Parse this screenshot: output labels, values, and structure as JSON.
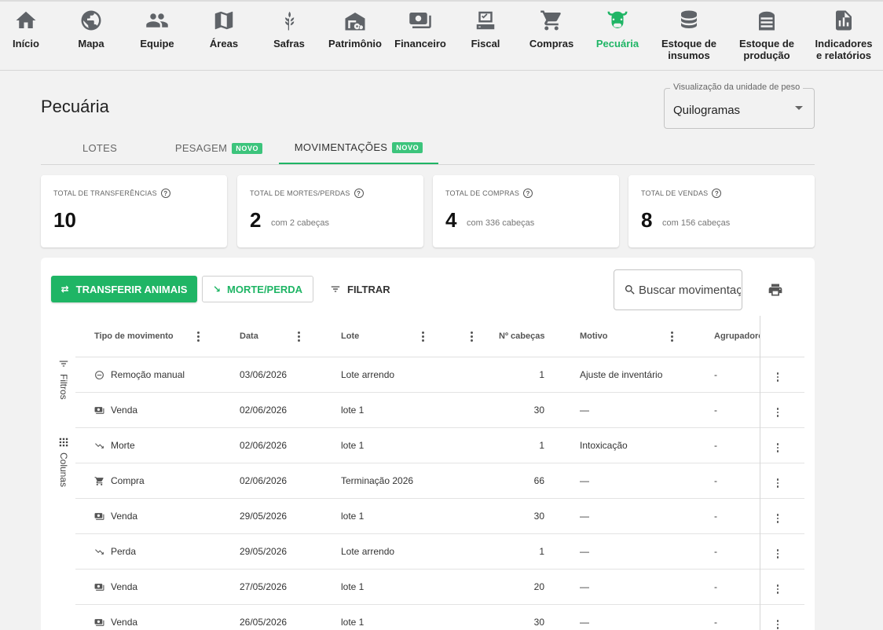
{
  "nav": [
    {
      "label": "Início",
      "icon": "home-icon"
    },
    {
      "label": "Mapa",
      "icon": "globe-icon"
    },
    {
      "label": "Equipe",
      "icon": "people-icon"
    },
    {
      "label": "Áreas",
      "icon": "map-icon"
    },
    {
      "label": "Safras",
      "icon": "wheat-icon"
    },
    {
      "label": "Patrimônio",
      "icon": "tractor-barn-icon"
    },
    {
      "label": "Financeiro",
      "icon": "money-icon"
    },
    {
      "label": "Fiscal",
      "icon": "fiscal-icon"
    },
    {
      "label": "Compras",
      "icon": "cart-icon"
    },
    {
      "label": "Pecuária",
      "icon": "cow-icon",
      "active": true
    },
    {
      "label": "Estoque de\ninsumos",
      "icon": "database-icon"
    },
    {
      "label": "Estoque de\nprodução",
      "icon": "silo-icon"
    },
    {
      "label": "Indicadores\ne relatórios",
      "icon": "report-icon"
    }
  ],
  "page": {
    "title": "Pecuária",
    "unit_select": {
      "legend": "Visualização da unidade de peso",
      "value": "Quilogramas"
    }
  },
  "tabs": [
    {
      "label": "LOTES"
    },
    {
      "label": "PESAGEM",
      "badge": "NOVO"
    },
    {
      "label": "MOVIMENTAÇÕES",
      "badge": "NOVO",
      "active": true
    }
  ],
  "stats": [
    {
      "caption": "TOTAL DE TRANSFERÊNCIAS",
      "value": "10",
      "sub": ""
    },
    {
      "caption": "TOTAL DE MORTES/PERDAS",
      "value": "2",
      "sub": "com 2 cabeças"
    },
    {
      "caption": "TOTAL DE COMPRAS",
      "value": "4",
      "sub": "com 336 cabeças"
    },
    {
      "caption": "TOTAL DE VENDAS",
      "value": "8",
      "sub": "com 156 cabeças"
    }
  ],
  "toolbar": {
    "transfer_label": "TRANSFERIR ANIMAIS",
    "death_label": "MORTE/PERDA",
    "filter_label": "FILTRAR",
    "search_placeholder": "Buscar movimentações"
  },
  "rail": {
    "filters": "Filtros",
    "columns": "Colunas"
  },
  "table": {
    "headers": {
      "type": "Tipo de movimento",
      "date": "Data",
      "lot": "Lote",
      "heads": "Nº cabeças",
      "reason": "Motivo",
      "group": "Agrupadores"
    },
    "rows": [
      {
        "type": "Remoção manual",
        "icon": "minus-circle-icon",
        "date": "03/06/2026",
        "lot": "Lote arrendo",
        "heads": "1",
        "reason": "Ajuste de inventário",
        "group": "-"
      },
      {
        "type": "Venda",
        "icon": "cash-icon",
        "date": "02/06/2026",
        "lot": "lote 1",
        "heads": "30",
        "reason": "—",
        "group": "-"
      },
      {
        "type": "Morte",
        "icon": "trending-down-icon",
        "date": "02/06/2026",
        "lot": "lote 1",
        "heads": "1",
        "reason": "Intoxicação",
        "group": "-"
      },
      {
        "type": "Compra",
        "icon": "cart-icon",
        "date": "02/06/2026",
        "lot": "Terminação 2026",
        "heads": "66",
        "reason": "—",
        "group": "-"
      },
      {
        "type": "Venda",
        "icon": "cash-icon",
        "date": "29/05/2026",
        "lot": "lote 1",
        "heads": "30",
        "reason": "—",
        "group": "-"
      },
      {
        "type": "Perda",
        "icon": "trending-down-icon",
        "date": "29/05/2026",
        "lot": "Lote arrendo",
        "heads": "1",
        "reason": "—",
        "group": "-"
      },
      {
        "type": "Venda",
        "icon": "cash-icon",
        "date": "27/05/2026",
        "lot": "lote 1",
        "heads": "20",
        "reason": "—",
        "group": "-"
      },
      {
        "type": "Venda",
        "icon": "cash-icon",
        "date": "26/05/2026",
        "lot": "lote 1",
        "heads": "30",
        "reason": "—",
        "group": "-"
      }
    ]
  },
  "colors": {
    "accent": "#1fb565",
    "badge": "#3cc47c"
  }
}
